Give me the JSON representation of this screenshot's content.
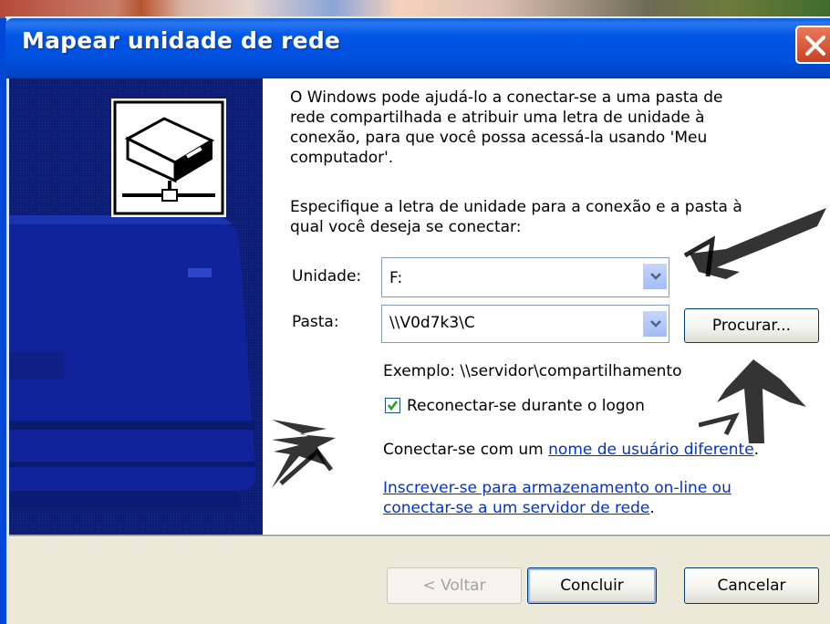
{
  "window": {
    "title": "Mapear unidade de rede",
    "close_label": "close"
  },
  "intro": {
    "line1": "O Windows pode ajudá-lo a conectar-se a uma pasta de",
    "line2": "rede compartilhada e atribuir uma letra de unidade à",
    "line3": "conexão, para que você possa acessá-la usando 'Meu",
    "line4": "computador'."
  },
  "instruction": {
    "line1": "Especifique a letra de unidade para a conexão e a pasta à",
    "line2": "qual você deseja se conectar:"
  },
  "form": {
    "drive_label": "Unidade:",
    "drive_value": "F:",
    "folder_label": "Pasta:",
    "folder_value": "\\\\V0d7k3\\C",
    "browse_label": "Procurar...",
    "example_text": "Exemplo: \\\\servidor\\compartilhamento",
    "reconnect_label": "Reconectar-se durante o logon",
    "reconnect_checked": true
  },
  "links": {
    "different_user_prefix": "Conectar-se com um ",
    "different_user_link": "nome de usuário diferente",
    "different_user_suffix": ".",
    "online_storage_line1": "Inscrever-se para armazenamento on-line ou",
    "online_storage_line2": "conectar-se a um servidor de rede",
    "online_storage_suffix": "."
  },
  "buttons": {
    "back": "< Voltar",
    "finish": "Concluir",
    "cancel": "Cancelar"
  },
  "colors": {
    "titlebar": "#0055e5",
    "side_panel": "#0c1c6b",
    "link": "#0033cc",
    "dialog_bg": "#ece9d8"
  },
  "icons": {
    "network_drive": "network-drive-icon",
    "dropdown": "chevron-down-icon",
    "close": "close-icon",
    "check": "check-icon"
  }
}
